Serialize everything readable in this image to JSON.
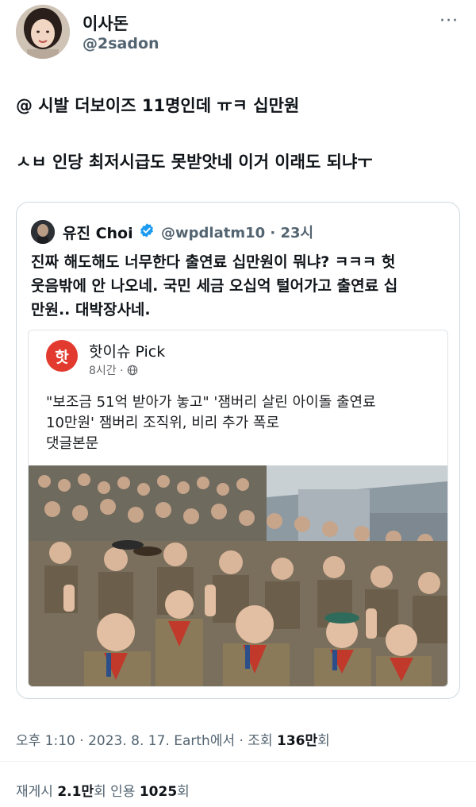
{
  "author": {
    "display_name": "이사돈",
    "handle": "@2sadon",
    "more_icon": "more-horizontal-icon"
  },
  "tweet": {
    "lines": [
      "@ 시발 더보이즈 11명인데 ㅠㅋ 십만원",
      "ㅅㅂ 인당 최저시급도 못받앗네 이거 이래도 되냐ㅜ"
    ]
  },
  "quote": {
    "author_name": "유진 Choi",
    "verified_icon": "verified-badge-icon",
    "handle_time": "@wpdlatm10 · 23시",
    "lines": [
      "진짜 해도해도 너무한다 출연료 십만원이 뭐냐? ㅋㅋㅋ 헛",
      "웃음밖에 안 나오네. 국민 세금 오십억 털어가고 출연료 십",
      "만원.. 대박장사네."
    ],
    "card": {
      "logo_text": "핫",
      "page_name": "핫이슈 Pick",
      "time": "8시간 · ",
      "globe_icon": "globe-icon",
      "lines": [
        "\"보조금 51억 받아가 놓고\" '잼버리 살린 아이돌 출연료",
        "10만원' 잼버리 조직위, 비리 추가 폭로",
        "댓글본문"
      ],
      "photo_icon": "crowd-photo"
    }
  },
  "meta": {
    "time": "오후 1:10",
    "sep1": " · ",
    "date": "2023. 8. 17.",
    "client": " Earth",
    "client_suffix": "에서 · 조회 ",
    "views": "136만",
    "views_suffix": "회"
  },
  "stats": {
    "retweets_label": "재게시 ",
    "retweets": "2.1만",
    "retweets_suffix": "회  인용 ",
    "quotes": "1025",
    "quotes_suffix": "회"
  }
}
